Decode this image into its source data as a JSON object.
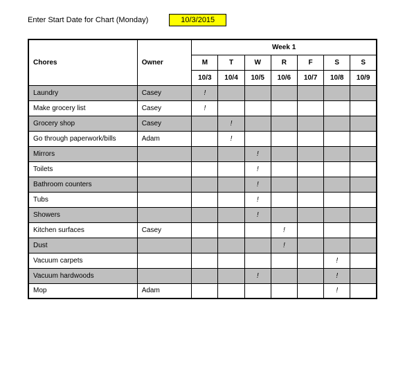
{
  "header": {
    "label": "Enter Start Date for Chart (Monday)",
    "date_value": "10/3/2015"
  },
  "table": {
    "chores_header": "Chores",
    "owner_header": "Owner",
    "week_header": "Week 1",
    "days": [
      "M",
      "T",
      "W",
      "R",
      "F",
      "S",
      "S"
    ],
    "dates": [
      "10/3",
      "10/4",
      "10/5",
      "10/6",
      "10/7",
      "10/8",
      "10/9"
    ],
    "rows": [
      {
        "chore": "Laundry",
        "owner": "Casey",
        "cells": [
          "!",
          "",
          "",
          "",
          "",
          "",
          ""
        ],
        "shaded": true
      },
      {
        "chore": "Make grocery list",
        "owner": "Casey",
        "cells": [
          "!",
          "",
          "",
          "",
          "",
          "",
          ""
        ],
        "shaded": false
      },
      {
        "chore": "Grocery shop",
        "owner": "Casey",
        "cells": [
          "",
          "!",
          "",
          "",
          "",
          "",
          ""
        ],
        "shaded": true
      },
      {
        "chore": "Go through paperwork/bills",
        "owner": "Adam",
        "cells": [
          "",
          "!",
          "",
          "",
          "",
          "",
          ""
        ],
        "shaded": false
      },
      {
        "chore": "Mirrors",
        "owner": "",
        "cells": [
          "",
          "",
          "!",
          "",
          "",
          "",
          ""
        ],
        "shaded": true
      },
      {
        "chore": "Toilets",
        "owner": "",
        "cells": [
          "",
          "",
          "!",
          "",
          "",
          "",
          ""
        ],
        "shaded": false
      },
      {
        "chore": "Bathroom counters",
        "owner": "",
        "cells": [
          "",
          "",
          "!",
          "",
          "",
          "",
          ""
        ],
        "shaded": true
      },
      {
        "chore": "Tubs",
        "owner": "",
        "cells": [
          "",
          "",
          "!",
          "",
          "",
          "",
          ""
        ],
        "shaded": false
      },
      {
        "chore": "Showers",
        "owner": "",
        "cells": [
          "",
          "",
          "!",
          "",
          "",
          "",
          ""
        ],
        "shaded": true
      },
      {
        "chore": "Kitchen surfaces",
        "owner": "Casey",
        "cells": [
          "",
          "",
          "",
          "!",
          "",
          "",
          ""
        ],
        "shaded": false
      },
      {
        "chore": "Dust",
        "owner": "",
        "cells": [
          "",
          "",
          "",
          "!",
          "",
          "",
          ""
        ],
        "shaded": true
      },
      {
        "chore": "Vacuum carpets",
        "owner": "",
        "cells": [
          "",
          "",
          "",
          "",
          "",
          "!",
          ""
        ],
        "shaded": false
      },
      {
        "chore": "Vacuum hardwoods",
        "owner": "",
        "cells": [
          "",
          "",
          "!",
          "",
          "",
          "!",
          ""
        ],
        "shaded": true
      },
      {
        "chore": "Mop",
        "owner": "Adam",
        "cells": [
          "",
          "",
          "",
          "",
          "",
          "!",
          ""
        ],
        "shaded": false
      }
    ]
  }
}
